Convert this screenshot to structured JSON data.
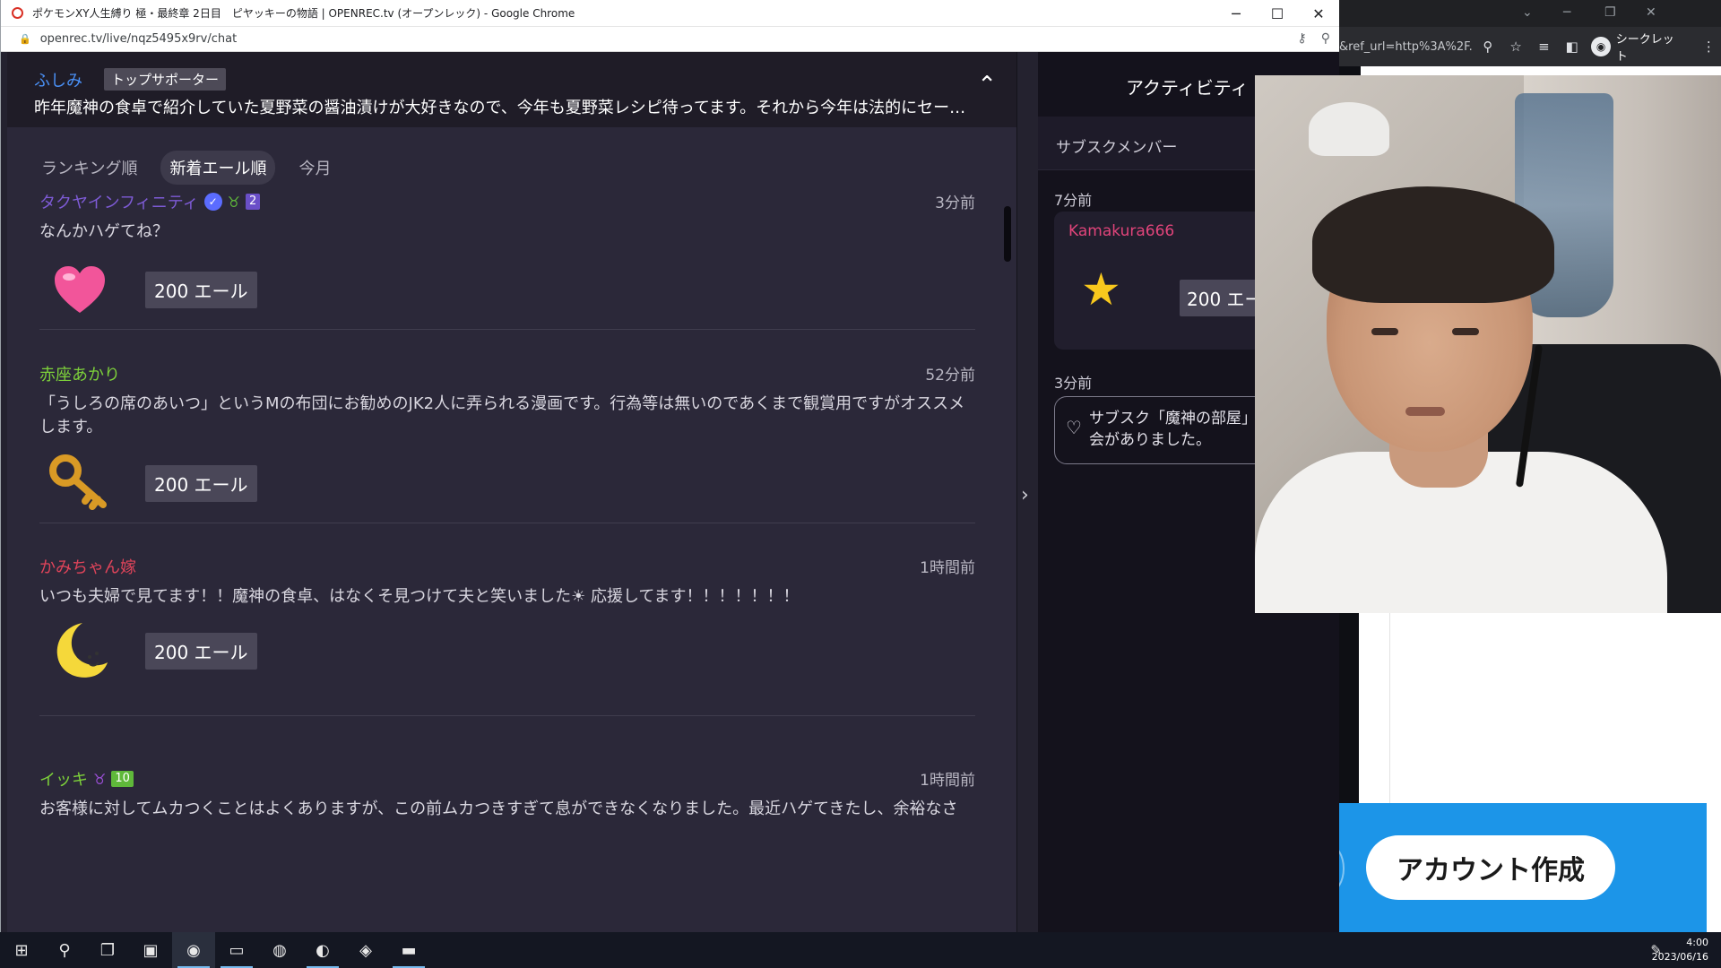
{
  "browser": {
    "title": "ポケモンXY人生縛り 極・最終章 2日目　ピヤッキーの物語 | OPENREC.tv (オープンレック) - Google Chrome",
    "url": "openrec.tv/live/nqz5495x9rv/chat",
    "controls": {
      "minimize": "─",
      "maximize": "☐",
      "close": "✕"
    }
  },
  "background_window": {
    "url_fragment": "&ref_url=http%3A%2F...",
    "incognito_label": "シークレット",
    "create_account_label": "アカウント作成"
  },
  "pinned": {
    "user": "ふしみ",
    "badge": "トップサポーター",
    "message": "昨年魔神の食卓で紹介していた夏野菜の醤油漬けが大好きなので、今年も夏野菜レシピ待ってます。それから今年は法的にセー…"
  },
  "tabs": [
    {
      "label": "ランキング順",
      "active": false
    },
    {
      "label": "新着エール順",
      "active": true
    },
    {
      "label": "今月",
      "active": false
    }
  ],
  "items": [
    {
      "name": "タクヤインフィニティ",
      "name_color": "#7e5bd6",
      "badge_num": "2",
      "badge_color": "#6a4fc8",
      "time": "3分前",
      "message": "なんかハゲてね？",
      "gift_icon": "heart-icon",
      "yell": "200 エール"
    },
    {
      "name": "赤座あかり",
      "name_color": "#7dd13a",
      "time": "52分前",
      "message": "「うしろの席のあいつ」というMの布団にお勧めのJK2人に弄られる漫画です。行為等は無いのであくまで観賞用ですがオススメします。",
      "gift_icon": "key-icon",
      "yell": "200 エール"
    },
    {
      "name": "かみちゃん嫁",
      "name_color": "#e0445a",
      "time": "1時間前",
      "message": "いつも夫婦で見てます！！魔神の食卓、はなくそ見つけて夫と笑いました☀ 応援してます！！！！！！！",
      "gift_icon": "moon-icon",
      "yell": "200 エール"
    },
    {
      "name": "イッキ",
      "name_color": "#7dd13a",
      "badge_num": "10",
      "badge_color": "#5fb83a",
      "time": "1時間前",
      "message": "お客様に対してムカつくことはよくありますが、この前ムカつきすぎて息ができなくなりました。最近ハゲてきたし、余裕なさ"
    }
  ],
  "activity": {
    "title": "アクティビティ",
    "tab": "サブスクメンバー",
    "entries": [
      {
        "time": "7分前",
        "user": "Kamakura666",
        "gift_icon": "star-icon",
        "yell": "200 エー"
      },
      {
        "time": "3分前",
        "text": "サブスク「魔神の部屋」\n会がありました。"
      }
    ]
  },
  "taskbar": {
    "time": "4:00",
    "date": "2023/06/16"
  },
  "colors": {
    "chat_bg": "#2b2839",
    "activity_bg": "#14121c",
    "accent_blue": "#1c95e8",
    "pinned_user": "#4a90f5",
    "activity_user": "#e0447a"
  }
}
